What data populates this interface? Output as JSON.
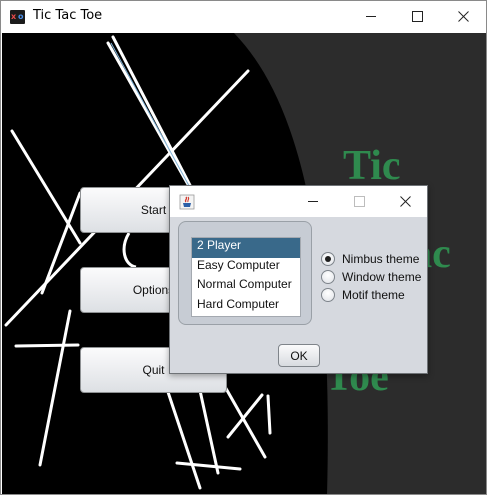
{
  "window": {
    "title": "Tic Tac Toe",
    "icon": "xo-app-icon",
    "controls": [
      "minimize-icon",
      "maximize-icon",
      "close-icon"
    ]
  },
  "logo": {
    "words": [
      "Tic",
      "Tac",
      "Toe"
    ],
    "color": "#2f8a4e"
  },
  "menu": {
    "start_label": "Start",
    "options_label": "Options",
    "quit_label": "Quit"
  },
  "dialog": {
    "title": "",
    "icon": "java-cup-icon",
    "game_modes": [
      {
        "label": "2 Player",
        "selected": true
      },
      {
        "label": "Easy Computer",
        "selected": false
      },
      {
        "label": "Normal Computer",
        "selected": false
      },
      {
        "label": "Hard Computer",
        "selected": false
      }
    ],
    "themes": [
      {
        "label": "Nimbus theme",
        "checked": true
      },
      {
        "label": "Window theme",
        "checked": false
      },
      {
        "label": "Motif theme",
        "checked": false
      }
    ],
    "ok_label": "OK"
  },
  "colors": {
    "background": "#000000",
    "panel": "#2c2c2c",
    "selection": "#39698a",
    "dialog_bg": "#d6d9df"
  }
}
